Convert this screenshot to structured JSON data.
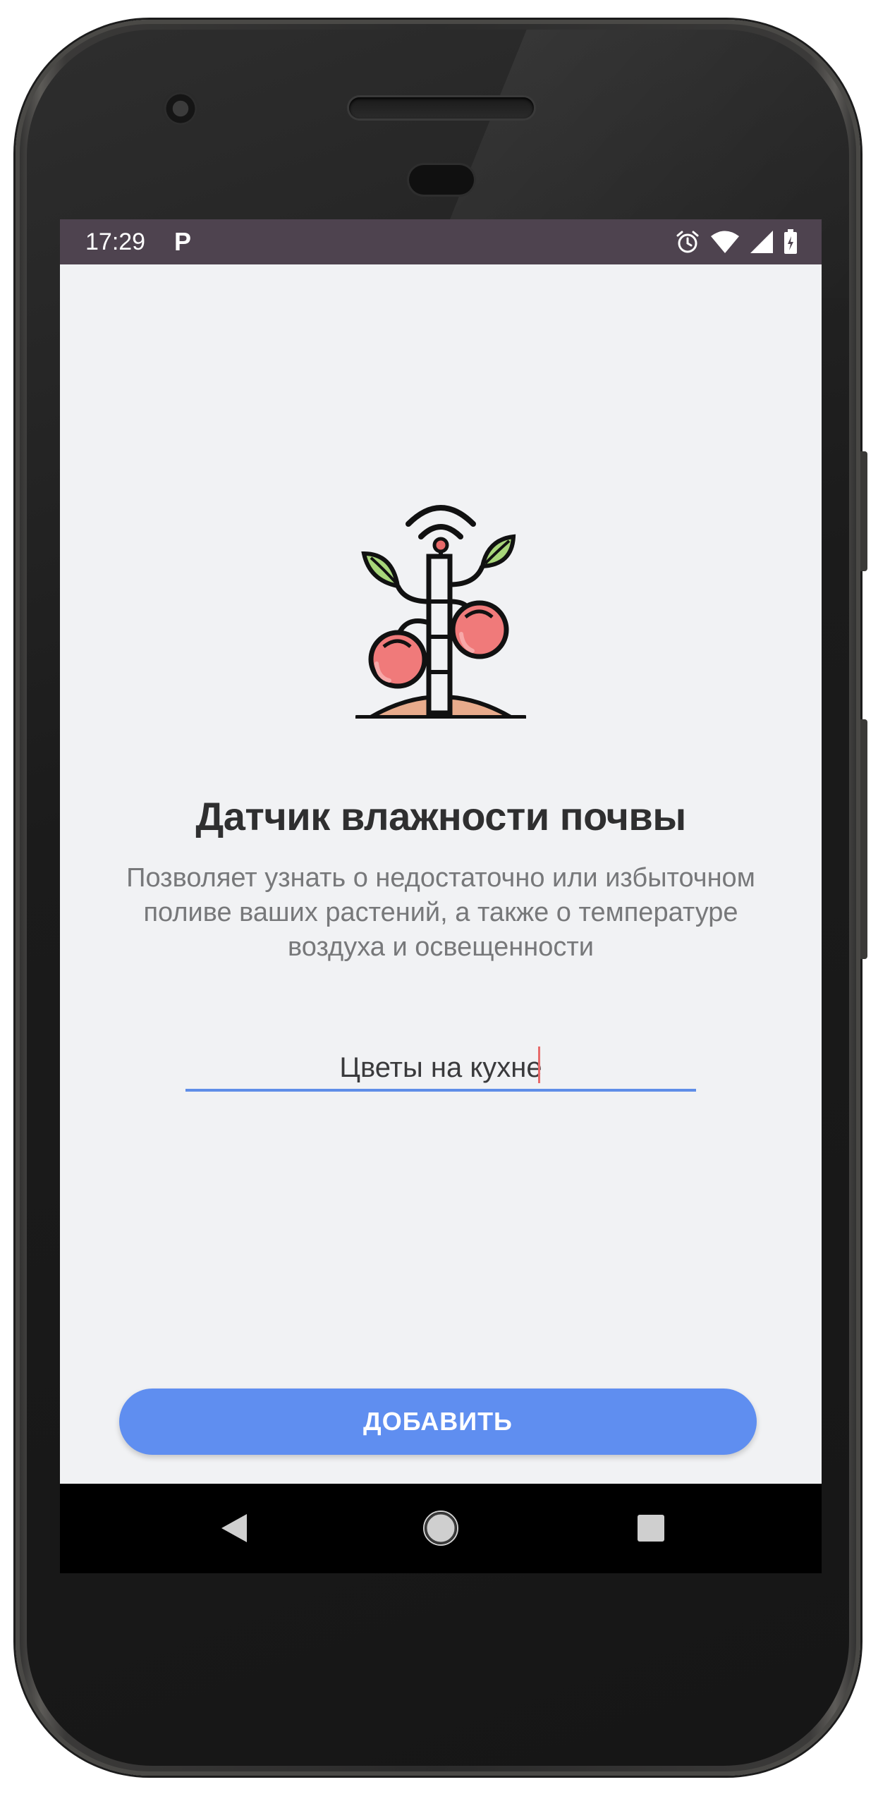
{
  "status_bar": {
    "time": "17:29",
    "notification_letter": "P",
    "icons": [
      "alarm-icon",
      "wifi-icon",
      "cell-signal-icon",
      "battery-icon"
    ]
  },
  "app": {
    "icon": "plant-sensor-icon",
    "title": "Датчик влажности почвы",
    "description": "Позволяет узнать о недостаточно или избыточном поливе ваших растений, а также о температуре воздуха и освещенности",
    "name_input": {
      "value": "Цветы на кухне",
      "placeholder": ""
    },
    "add_button_label": "ДОБАВИТЬ"
  },
  "navigation": {
    "buttons": [
      "back-icon",
      "home-icon",
      "recents-icon"
    ]
  },
  "colors": {
    "accent": "#5f8ef0",
    "status_bar": "#4e434f",
    "screen_bg": "#f1f2f4",
    "title_text": "#2f2f30",
    "body_text": "#77787a",
    "caret": "#e76b6b"
  }
}
